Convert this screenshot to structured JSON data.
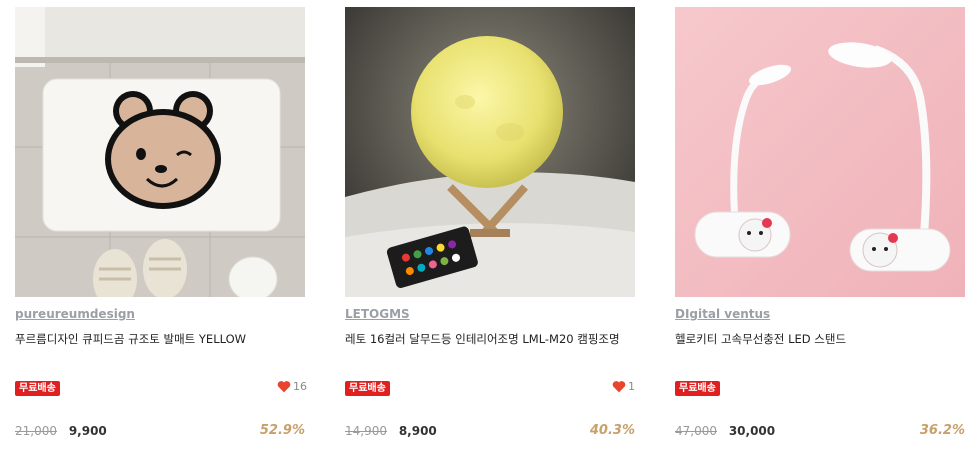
{
  "products": [
    {
      "brand": "pureureumdesign",
      "title": "푸르름디자인 큐피드곰 규조토 발매트 YELLOW",
      "badge": "무료배송",
      "likes": "16",
      "original_price": "21,000",
      "sale_price": "9,900",
      "discount": "52.9%"
    },
    {
      "brand": "LETOGMS",
      "title": "레토 16컬러 달무드등 인테리어조명 LML-M20 캠핑조명",
      "badge": "무료배송",
      "likes": "1",
      "original_price": "14,900",
      "sale_price": "8,900",
      "discount": "40.3%"
    },
    {
      "brand": "DIgital ventus",
      "title": "헬로키티 고속무선충전 LED 스탠드",
      "badge": "무료배송",
      "original_price": "47,000",
      "sale_price": "30,000",
      "discount": "36.2%"
    }
  ],
  "colors": {
    "badge_red": "#e02020",
    "heart_red": "#e8452f",
    "discount_gold": "#c8a06a",
    "brand_gray": "#9aa0a6"
  },
  "icons": [
    "heart-icon"
  ]
}
